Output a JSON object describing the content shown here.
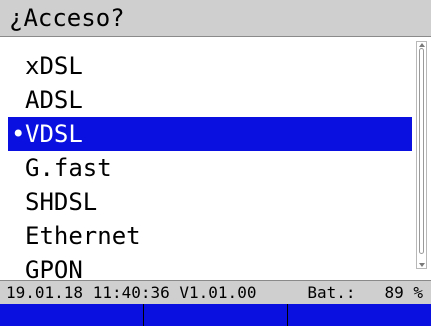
{
  "title": "¿Acceso?",
  "menu": {
    "items": [
      {
        "label": "xDSL",
        "selected": false
      },
      {
        "label": "ADSL",
        "selected": false
      },
      {
        "label": "VDSL",
        "selected": true
      },
      {
        "label": "G.fast",
        "selected": false
      },
      {
        "label": "SHDSL",
        "selected": false
      },
      {
        "label": "Ethernet",
        "selected": false
      },
      {
        "label": "GPON",
        "selected": false
      }
    ],
    "selected_bullet": "•"
  },
  "status": {
    "datetime_version": "19.01.18 11:40:36 V1.01.00",
    "battery_label": "Bat.:",
    "battery_value": "89 %"
  },
  "softkeys": [
    "",
    "",
    ""
  ],
  "colors": {
    "selection": "#0a10e0",
    "softkey_bar": "#0a10e0",
    "title_bar": "#cfcfcf",
    "status_bar": "#cfcfcf"
  }
}
